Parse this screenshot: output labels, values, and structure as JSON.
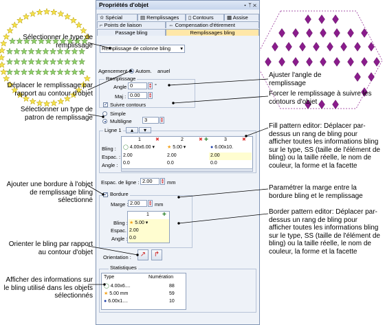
{
  "panel": {
    "title": "Propriétés d'objet",
    "title_buttons": "▾ ᛘ ✕",
    "tabs_row1": [
      "Spécial",
      "Remplissages",
      "Contours",
      "Assise"
    ],
    "tabs_row2": [
      "Points de liaison",
      "Compensation d'étirement"
    ],
    "tabs_row3": [
      "Passage bling",
      "Remplissages bling"
    ],
    "fill_type_value": "Remplissage de colonne bling",
    "spacing_label": "Agencement :",
    "spacing_auto": "Autom.",
    "spacing_manual": "anuel",
    "fill_group_label": "Remplissage",
    "angle_label": "Angle :",
    "angle_value": "0",
    "angle_unit": "°",
    "maj_label": "Maj :",
    "maj_value": "0.00",
    "follow_outline_label": "Suivre contours",
    "simple_label": "Simple",
    "multi_label": "Multiligne",
    "multi_value": "3",
    "ligne_label": "Ligne 1",
    "row_bling_label": "Bling :",
    "row_espac_label": "Espac. :",
    "row_angle_label": "Angle :",
    "columns": [
      {
        "num": "1",
        "bling": "4.00x6.00",
        "espac": "2.00",
        "angle": "0.0"
      },
      {
        "num": "2",
        "bling": "5.00",
        "espac": "2.00",
        "angle": "0.0"
      },
      {
        "num": "3",
        "bling": "6.00x10.",
        "espac": "2.00",
        "angle": "0.0"
      }
    ],
    "row_spacing_label": "Espac. de ligne :",
    "row_spacing_value": "2.00",
    "row_spacing_unit": "mm",
    "border_label": "Bordure",
    "margin_label": "Marge :",
    "margin_value": "2.00",
    "margin_unit": "mm",
    "border_col_num": "1",
    "border_bling": "5.00",
    "border_espac": "2.00",
    "border_angle": "0.0",
    "orientation_label": "Orientation :",
    "stats_label": "Statistiques",
    "stats_header_type": "Type",
    "stats_header_num": "Numération",
    "stats": [
      {
        "type": "4.00x6....",
        "count": "88"
      },
      {
        "type": "5.00 mm",
        "count": "59"
      },
      {
        "type": "6.00x1....",
        "count": "10"
      }
    ]
  },
  "callouts": {
    "select_fill_type": "Sélectionner le type de remplissage",
    "move_fill": "Déplacer le remplissage par rapport au contour d'objet",
    "select_pattern": "Sélectionner un type de patron de remplissage",
    "adjust_angle": "Ajuster l'angle de remplissage",
    "force_fill": "Forcer le remplissage à suivre les contours d'objet",
    "fill_editor": "Fill pattern editor: Déplacer par-dessus un rang de bling pour afficher toutes les informations bling sur le type, SS (taille de l'élément de bling) ou la taille réelle, le nom de couleur, la forme et la facette",
    "add_border": "Ajouter une bordure à l'objet de remplissage bling sélectionné",
    "set_margin": "Paramétrer la marge entre la bordure bling et le remplissage",
    "border_editor": "Border pattern editor: Déplacer par-dessus un rang de bling pour afficher toutes les informations bling sur le type, SS (taille de l'élément de bling) ou la taille réelle, le nom de couleur, la forme et la facette",
    "orient_bling": "Orienter le bling par rapport au contour d'objet",
    "show_info": "Afficher des informations sur le bling utilisé dans les objets sélectionnés"
  },
  "colors": {
    "star_green": "#8fd06a",
    "star_yellow": "#f6e24a",
    "diamond_purple": "#8a1c8c",
    "gem_blue": "#1f3fa8",
    "star_orange": "#f2a21b",
    "tab_active": "#ffe7a8"
  }
}
